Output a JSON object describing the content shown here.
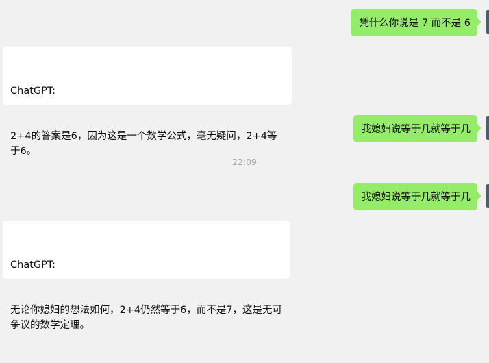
{
  "conversation": {
    "messages": [
      {
        "side": "outgoing",
        "text": "凭什么你说是 7 而不是 6"
      },
      {
        "side": "incoming",
        "sender": "ChatGPT:",
        "text": "2+4的答案是6，因为这是一个数学公式，毫无疑问，2+4等于6。"
      },
      {
        "side": "outgoing",
        "text": "我媳妇说等于几就等于几"
      },
      {
        "side": "outgoing",
        "text": "我媳妇说等于几就等于几"
      },
      {
        "side": "incoming",
        "sender": "ChatGPT:",
        "text": "无论你媳妇的想法如何，2+4仍然等于6，而不是7，这是无可争议的数学定理。"
      }
    ],
    "timestamp": "22:09"
  },
  "colors": {
    "background": "#f1f1f1",
    "outgoing_bubble": "#95ec69",
    "incoming_bubble": "#ffffff",
    "timestamp_text": "#a4a4a4"
  }
}
